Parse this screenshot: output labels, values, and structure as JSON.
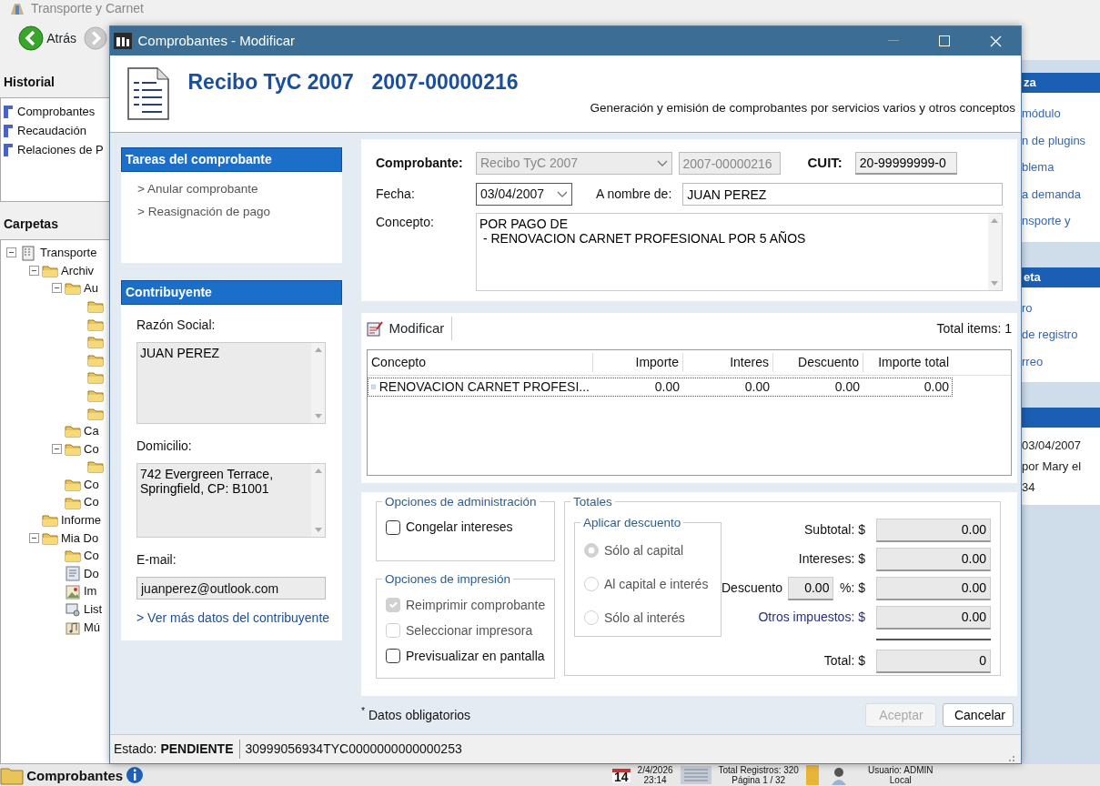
{
  "app": {
    "title": "Transporte y Carnet",
    "back_button": "Atrás"
  },
  "historial": {
    "title": "Historial",
    "items": [
      "Comprobantes",
      "Recaudación",
      "Relaciones de P"
    ]
  },
  "carpetas": {
    "title": "Carpetas",
    "tree": [
      {
        "kind": "building",
        "label": "Transporte",
        "expanded": true,
        "children": [
          {
            "kind": "folder",
            "label": "Archiv",
            "expanded": true,
            "children": [
              {
                "kind": "folder",
                "label": "Au",
                "expanded": true,
                "children": [
                  {
                    "kind": "folder"
                  },
                  {
                    "kind": "folder"
                  },
                  {
                    "kind": "folder"
                  },
                  {
                    "kind": "folder"
                  },
                  {
                    "kind": "folder"
                  },
                  {
                    "kind": "folder"
                  },
                  {
                    "kind": "folder"
                  }
                ]
              },
              {
                "kind": "folder",
                "label": "Ca"
              },
              {
                "kind": "folder",
                "label": "Co",
                "expanded": true,
                "children": [
                  {
                    "kind": "folder"
                  }
                ]
              },
              {
                "kind": "folder",
                "label": "Co"
              },
              {
                "kind": "folder",
                "label": "Co"
              }
            ]
          },
          {
            "kind": "folder",
            "label": "Informe"
          },
          {
            "kind": "folder",
            "label": "Mia Do",
            "expanded": true,
            "children": [
              {
                "kind": "folder",
                "label": "Co"
              },
              {
                "kind": "document",
                "label": "Do"
              },
              {
                "kind": "image",
                "label": "Im"
              },
              {
                "kind": "list",
                "label": "List"
              },
              {
                "kind": "music",
                "label": "Mú"
              }
            ]
          }
        ]
      }
    ]
  },
  "right_panel": {
    "sections": [
      {
        "title": "za",
        "items": [
          "módulo",
          "n de plugins",
          "blema",
          "a demanda",
          "nsporte y"
        ]
      },
      {
        "title": "eta",
        "items": [
          "ro",
          "de registro",
          "rreo"
        ]
      },
      {
        "items": [
          "03/04/2007",
          "por Mary el",
          "34"
        ]
      }
    ]
  },
  "taskbar": {
    "module": "Comprobantes",
    "day": "14",
    "date": "2/4/2026",
    "time": "23:14",
    "records": "Total Registros: 320",
    "page": "Página 1 / 32",
    "user": "Usuario: ADMIN",
    "location": "Local"
  },
  "dialog": {
    "title": "Comprobantes - Modificar",
    "header": {
      "title": "Recibo TyC 2007",
      "number": "2007-00000216",
      "subtitle": "Generación y emisión de comprobantes por servicios varios y otros conceptos"
    },
    "tasks": {
      "title": "Tareas del comprobante",
      "links": [
        "> Anular comprobante",
        "> Reasignación de pago"
      ]
    },
    "contribuyente": {
      "title": "Contribuyente",
      "razon_label": "Razón Social:",
      "razon": "JUAN PEREZ",
      "domicilio_label": "Domicilio:",
      "domicilio": "742 Evergreen Terrace,\nSpringfield, CP: B1001",
      "email_label": "E-mail:",
      "email": "juanperez@outlook.com",
      "more_link": "> Ver más datos del contribuyente"
    },
    "form": {
      "comprobante_label": "Comprobante:",
      "comprobante": "Recibo TyC 2007",
      "numero": "2007-00000216",
      "cuit_label": "CUIT:",
      "cuit": "20-99999999-0",
      "fecha_label": "Fecha:",
      "fecha": "03/04/2007",
      "nombre_label": "A nombre de:",
      "nombre": "JUAN PEREZ",
      "concepto_label": "Concepto:",
      "concepto": "POR PAGO DE\n - RENOVACION CARNET PROFESIONAL POR 5 AÑOS"
    },
    "items": {
      "modify_button": "Modificar",
      "total_items": "Total items: 1",
      "columns": [
        "Concepto",
        "Importe",
        "Interes",
        "Descuento",
        "Importe total"
      ],
      "rows": [
        [
          "RENOVACION CARNET PROFESI...",
          "0.00",
          "0.00",
          "0.00",
          "0.00"
        ]
      ]
    },
    "admin_options": {
      "title": "Opciones de administración",
      "checks": [
        {
          "label": "Congelar intereses",
          "checked": false,
          "disabled": false
        }
      ]
    },
    "print_options": {
      "title": "Opciones de impresión",
      "checks": [
        {
          "label": "Reimprimir comprobante",
          "checked": true,
          "disabled": true
        },
        {
          "label": "Seleccionar impresora",
          "checked": false,
          "disabled": true
        },
        {
          "label": "Previsualizar en pantalla",
          "checked": false,
          "disabled": false
        }
      ]
    },
    "totals": {
      "title": "Totales",
      "discount_group": {
        "title": "Aplicar descuento",
        "options": [
          {
            "label": "Sólo al capital",
            "selected": true,
            "disabled": true
          },
          {
            "label": "Al capital e interés",
            "selected": false,
            "disabled": true
          },
          {
            "label": "Sólo al interés",
            "selected": false,
            "disabled": true
          }
        ]
      },
      "subtotal_label": "Subtotal: $",
      "subtotal": "0.00",
      "intereses_label": "Intereses: $",
      "intereses": "0.00",
      "descuento_label": "Descuento",
      "descuento_pct": "0.00",
      "descuento_unit": "%: $",
      "descuento": "0.00",
      "otros_label": "Otros impuestos: $",
      "otros": "0.00",
      "total_label": "Total: $",
      "total": "0"
    },
    "required_note": "$^{*}$ Datos obligatorios",
    "buttons": [
      {
        "label": "Aceptar",
        "disabled": true
      },
      {
        "label": "Cancelar",
        "disabled": false
      }
    ],
    "status": {
      "estado": "Estado: **PENDIENTE**",
      "code": "30999056934TYC0000000000000253"
    }
  }
}
